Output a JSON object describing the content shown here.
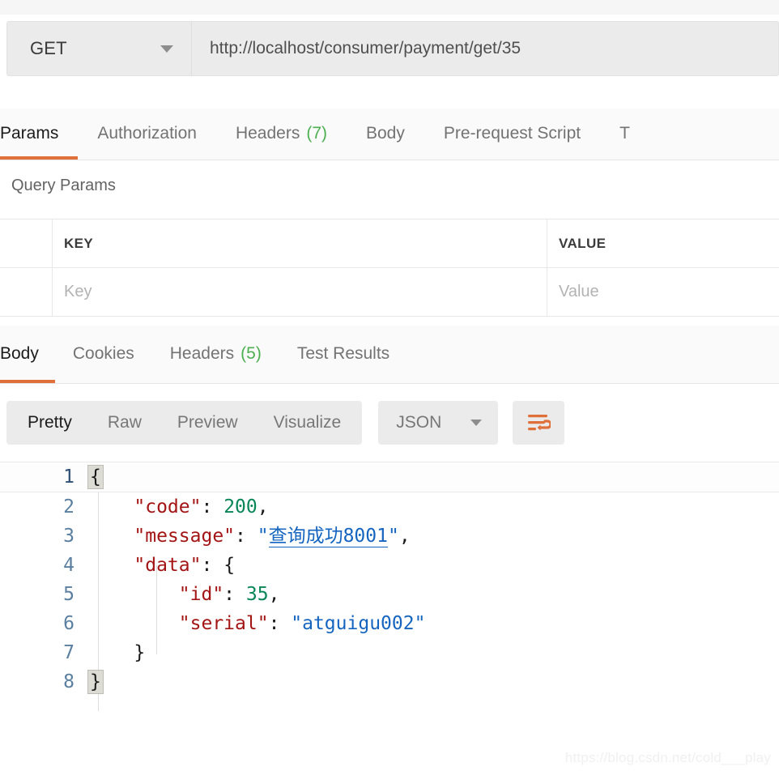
{
  "request": {
    "method_label": "GET",
    "method_caret_icon": "chevron-down-icon",
    "url_value": "http://localhost/consumer/payment/get/35",
    "url_placeholder": "Enter request URL"
  },
  "request_tabs": [
    {
      "label": "Params",
      "count": "",
      "active": true
    },
    {
      "label": "Authorization",
      "count": "",
      "active": false
    },
    {
      "label": "Headers",
      "count": "(7)",
      "active": false
    },
    {
      "label": "Body",
      "count": "",
      "active": false
    },
    {
      "label": "Pre-request Script",
      "count": "",
      "active": false
    },
    {
      "label": "T",
      "count": "",
      "active": false
    }
  ],
  "query_params": {
    "section_title": "Query Params",
    "columns": [
      "",
      "KEY",
      "VALUE"
    ],
    "rows": [
      {
        "check": "",
        "key_placeholder": "Key",
        "value_placeholder": "Value"
      }
    ]
  },
  "response_tabs": [
    {
      "label": "Body",
      "count": "",
      "active": true
    },
    {
      "label": "Cookies",
      "count": "",
      "active": false
    },
    {
      "label": "Headers",
      "count": "(5)",
      "active": false
    },
    {
      "label": "Test Results",
      "count": "",
      "active": false
    }
  ],
  "viewer": {
    "modes": [
      {
        "label": "Pretty",
        "active": true
      },
      {
        "label": "Raw",
        "active": false
      },
      {
        "label": "Preview",
        "active": false
      },
      {
        "label": "Visualize",
        "active": false
      }
    ],
    "format_label": "JSON",
    "format_caret_icon": "chevron-down-icon",
    "wrap_button_icon": "word-wrap-icon"
  },
  "response_body": {
    "language": "json",
    "lines": [
      {
        "no": "1",
        "active": true,
        "segments": [
          {
            "t": "{",
            "c": "punc",
            "hl": true
          }
        ]
      },
      {
        "no": "2",
        "active": false,
        "segments": [
          {
            "t": "    ",
            "c": "punc"
          },
          {
            "t": "\"code\"",
            "c": "key"
          },
          {
            "t": ": ",
            "c": "punc"
          },
          {
            "t": "200",
            "c": "num"
          },
          {
            "t": ",",
            "c": "punc"
          }
        ]
      },
      {
        "no": "3",
        "active": false,
        "segments": [
          {
            "t": "    ",
            "c": "punc"
          },
          {
            "t": "\"message\"",
            "c": "key"
          },
          {
            "t": ": ",
            "c": "punc"
          },
          {
            "t": "\"",
            "c": "str"
          },
          {
            "t": "查询成功8001",
            "c": "str-cjk"
          },
          {
            "t": "\"",
            "c": "str"
          },
          {
            "t": ",",
            "c": "punc"
          }
        ]
      },
      {
        "no": "4",
        "active": false,
        "segments": [
          {
            "t": "    ",
            "c": "punc"
          },
          {
            "t": "\"data\"",
            "c": "key"
          },
          {
            "t": ": ",
            "c": "punc"
          },
          {
            "t": "{",
            "c": "punc"
          }
        ]
      },
      {
        "no": "5",
        "active": false,
        "segments": [
          {
            "t": "        ",
            "c": "punc"
          },
          {
            "t": "\"id\"",
            "c": "key"
          },
          {
            "t": ": ",
            "c": "punc"
          },
          {
            "t": "35",
            "c": "num"
          },
          {
            "t": ",",
            "c": "punc"
          }
        ]
      },
      {
        "no": "6",
        "active": false,
        "segments": [
          {
            "t": "        ",
            "c": "punc"
          },
          {
            "t": "\"serial\"",
            "c": "key"
          },
          {
            "t": ": ",
            "c": "punc"
          },
          {
            "t": "\"atguigu002\"",
            "c": "str"
          }
        ]
      },
      {
        "no": "7",
        "active": false,
        "segments": [
          {
            "t": "    ",
            "c": "punc"
          },
          {
            "t": "}",
            "c": "punc"
          }
        ]
      },
      {
        "no": "8",
        "active": false,
        "segments": [
          {
            "t": "}",
            "c": "punc",
            "hl": true
          }
        ]
      }
    ]
  },
  "watermark": {
    "text": "https://blog.csdn.net/cold___play"
  },
  "colors": {
    "accent": "#e0703a",
    "tab_count": "#4caf50",
    "json_key": "#a31515",
    "json_number": "#098658",
    "json_string": "#1565c0",
    "field_bg": "#ebebeb"
  }
}
